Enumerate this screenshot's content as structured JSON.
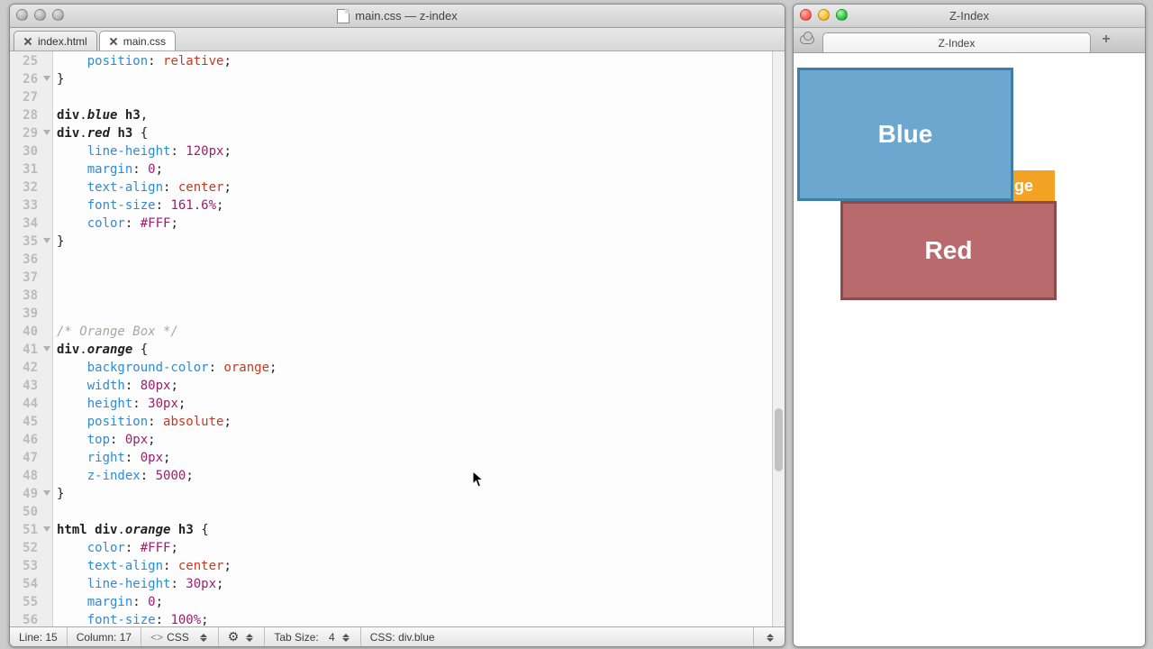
{
  "editor": {
    "title": "main.css — z-index",
    "tabs": [
      {
        "label": "index.html",
        "active": false
      },
      {
        "label": "main.css",
        "active": true
      }
    ],
    "first_line_no": 25,
    "fold_lines": [
      26,
      29,
      35,
      41,
      49,
      51
    ],
    "lines": {
      "25": "    position: relative;",
      "26": "}",
      "27": "",
      "28": "div.blue h3,",
      "29": "div.red h3 {",
      "30": "    line-height: 120px;",
      "31": "    margin: 0;",
      "32": "    text-align: center;",
      "33": "    font-size: 161.6%;",
      "34": "    color: #FFF;",
      "35": "}",
      "36": "",
      "37": "",
      "38": "",
      "39": "",
      "40": "/* Orange Box */",
      "41": "div.orange {",
      "42": "    background-color: orange;",
      "43": "    width: 80px;",
      "44": "    height: 30px;",
      "45": "    position: absolute;",
      "46": "    top: 0px;",
      "47": "    right: 0px;",
      "48": "    z-index: 5000;",
      "49": "}",
      "50": "",
      "51": "html div.orange h3 {",
      "52": "    color: #FFF;",
      "53": "    text-align: center;",
      "54": "    line-height: 30px;",
      "55": "    margin: 0;",
      "56": "    font-size: 100%;"
    },
    "status": {
      "line": "Line: 15",
      "column": "Column: 17",
      "lang": "CSS",
      "tab_size_label": "Tab Size:",
      "tab_size_value": "4",
      "scope": "CSS: div.blue"
    }
  },
  "browser": {
    "title": "Z-Index",
    "tab_title": "Z-Index",
    "boxes": {
      "blue": "Blue",
      "red": "Red",
      "orange": "nge"
    }
  }
}
